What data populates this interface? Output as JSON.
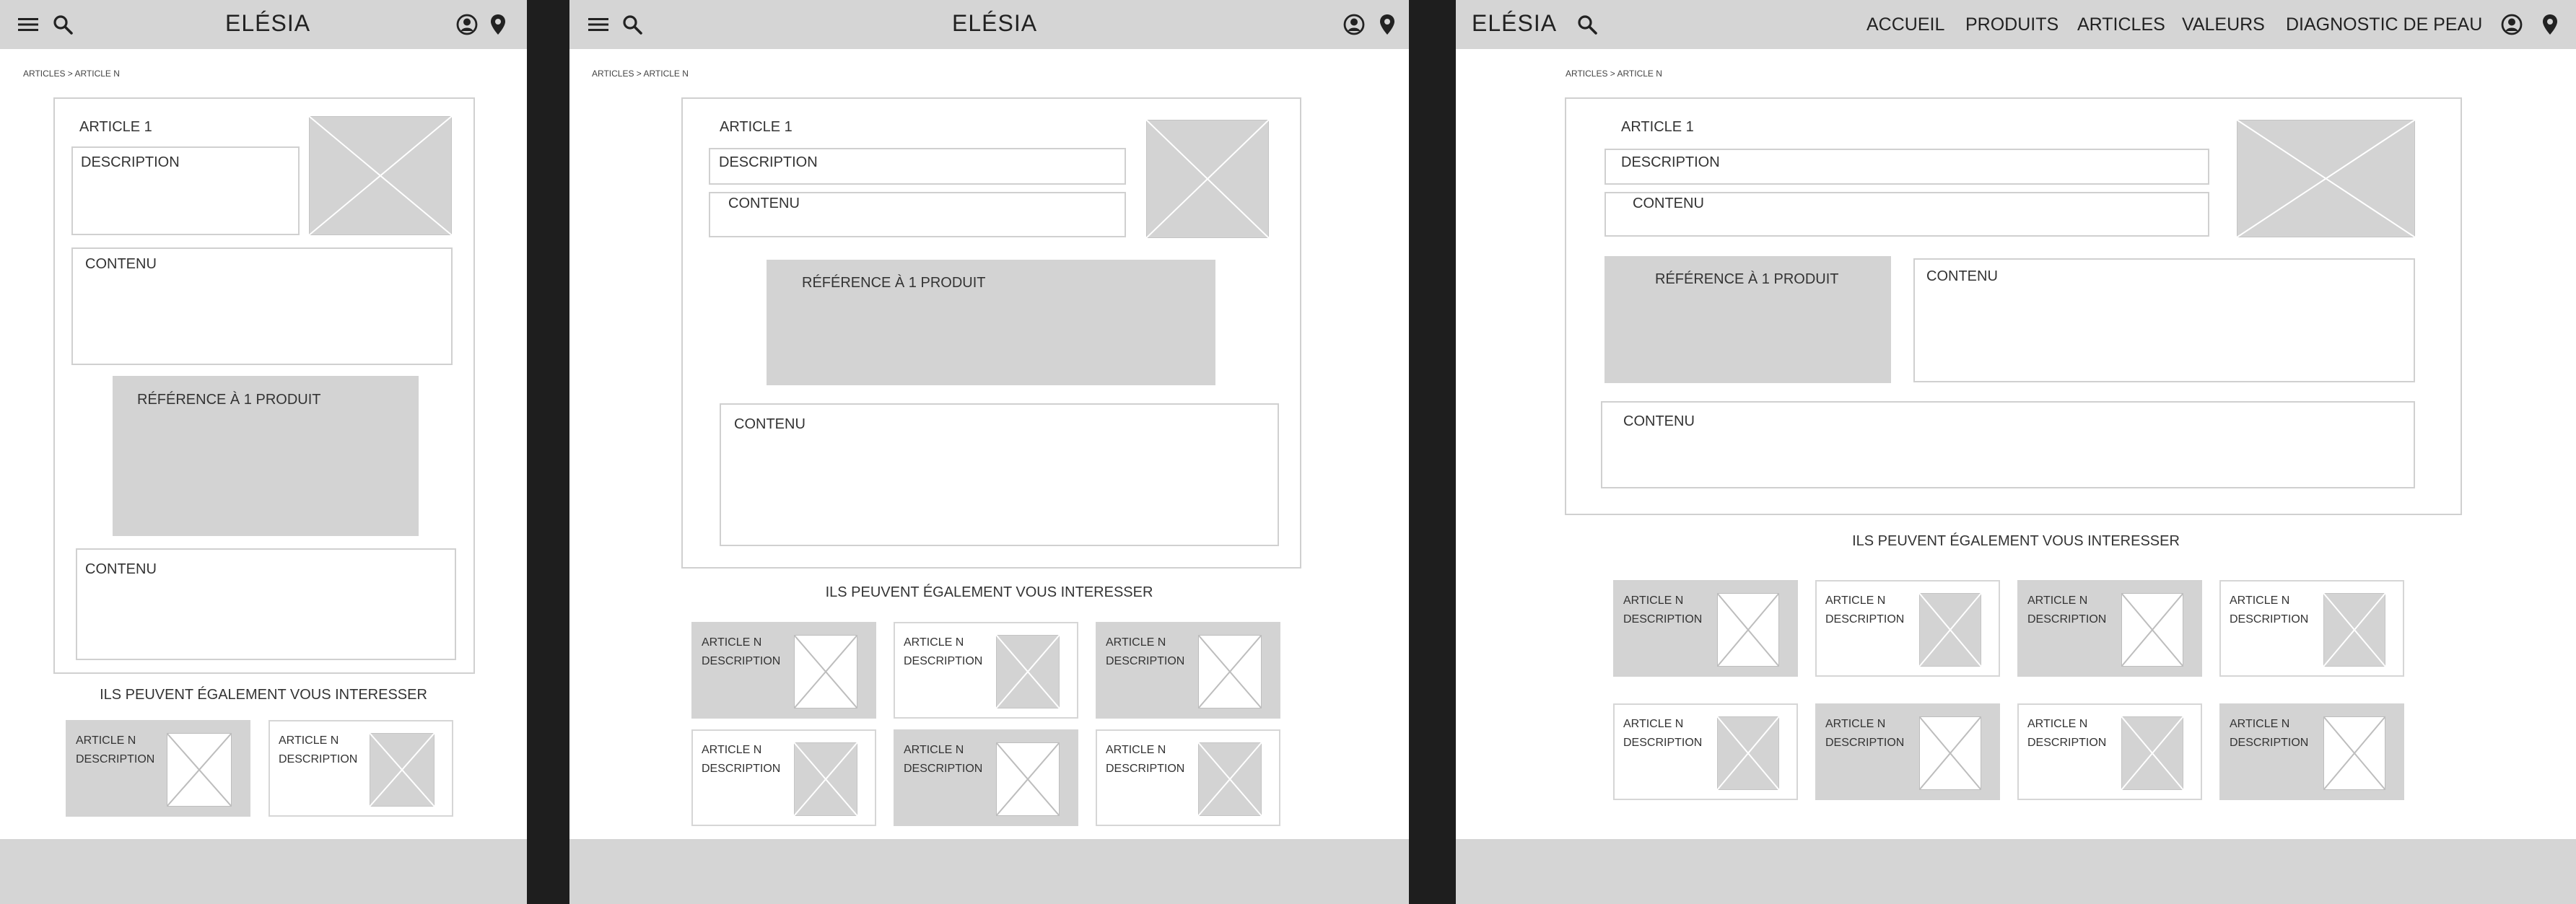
{
  "brand": "ELÉSIA",
  "breadcrumb": "ARTICLES > ARTICLE N",
  "article": {
    "title": "ARTICLE 1",
    "description": "DESCRIPTION",
    "content": "CONTENU",
    "product_reference": "RÉFÉRENCE À 1 PRODUIT"
  },
  "related": {
    "heading": "ILS PEUVENT ÉGALEMENT VOUS INTERESSER",
    "card_title": "ARTICLE N",
    "card_desc": "DESCRIPTION"
  },
  "nav": {
    "items": [
      "ACCUEIL",
      "PRODUITS",
      "ARTICLES",
      "VALEURS",
      "DIAGNOSTIC DE PEAU"
    ]
  },
  "icons": {
    "menu": "hamburger-menu-icon",
    "search": "search-icon",
    "account": "user-account-icon",
    "location": "location-pin-icon",
    "image_placeholder": "image-placeholder-icon"
  },
  "colors": {
    "page_bg": "#1e1e1e",
    "frame_bg": "#ffffff",
    "header_bg": "#d5d5d5",
    "placeholder_grey": "#d3d3d3",
    "border": "#d0d0d0"
  }
}
